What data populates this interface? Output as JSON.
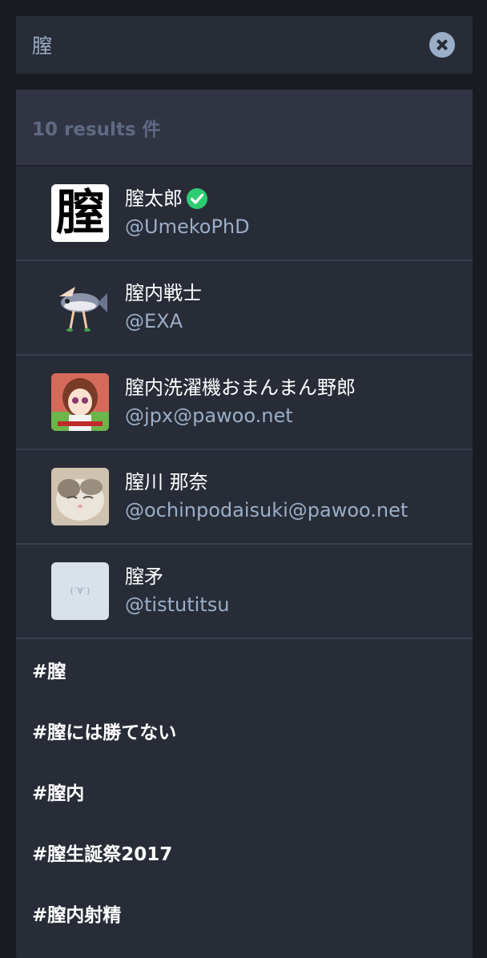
{
  "search": {
    "query": "膣"
  },
  "results": {
    "header": "10 results 件",
    "accounts": [
      {
        "display_name": "膣太郎",
        "handle": "@UmekoPhD",
        "verified": true,
        "avatar_char": "膣"
      },
      {
        "display_name": "膣内戦士",
        "handle": "@EXA"
      },
      {
        "display_name": "膣内洗濯機おまんまん野郎",
        "handle": "@jpx@pawoo.net"
      },
      {
        "display_name": "膣川 那奈",
        "handle": "@ochinpodaisuki@pawoo.net"
      },
      {
        "display_name": "膣矛",
        "handle": "@tistutitsu",
        "avatar_text": "(´∀`)"
      }
    ],
    "hashtags": [
      "#膣",
      "#膣には勝てない",
      "#膣内",
      "#膣生誕祭2017",
      "#膣内射精"
    ]
  },
  "colors": {
    "background": "#191b22",
    "panel": "#282c37",
    "header": "#313543",
    "muted_text": "#9baec8",
    "verified": "#79bd9a"
  }
}
